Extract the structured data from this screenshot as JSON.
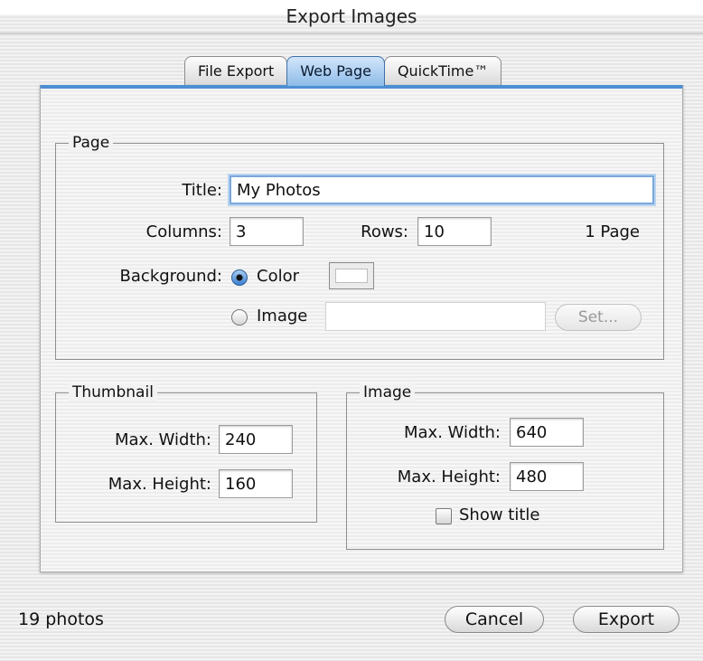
{
  "window": {
    "title": "Export Images"
  },
  "tabs": [
    {
      "label": "File Export",
      "active": false
    },
    {
      "label": "Web Page",
      "active": true
    },
    {
      "label": "QuickTime™",
      "active": false
    }
  ],
  "page_group": {
    "legend": "Page",
    "title_label": "Title:",
    "title_value": "My Photos",
    "columns_label": "Columns:",
    "columns_value": "3",
    "rows_label": "Rows:",
    "rows_value": "10",
    "pages_text": "1 Page",
    "background_label": "Background:",
    "color_option": "Color",
    "image_option": "Image",
    "selected_background": "Color",
    "image_path_value": "",
    "set_button": "Set..."
  },
  "thumbnail_group": {
    "legend": "Thumbnail",
    "max_width_label": "Max. Width:",
    "max_width_value": "240",
    "max_height_label": "Max. Height:",
    "max_height_value": "160"
  },
  "image_group": {
    "legend": "Image",
    "max_width_label": "Max. Width:",
    "max_width_value": "640",
    "max_height_label": "Max. Height:",
    "max_height_value": "480",
    "show_title_label": "Show title",
    "show_title_checked": false
  },
  "footer": {
    "photo_count": "19 photos",
    "cancel_button": "Cancel",
    "export_button": "Export"
  },
  "colors": {
    "active_tab": "#8dbbe8",
    "panel_accent": "#4d8fd3",
    "focus_ring": "#7aa7db"
  }
}
